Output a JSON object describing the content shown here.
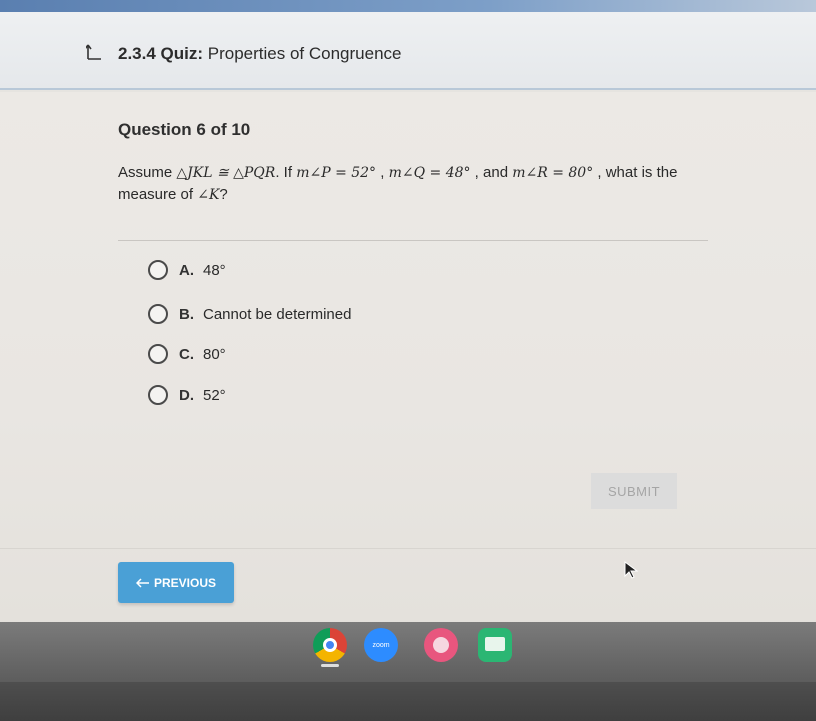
{
  "header": {
    "quiz_label": "2.3.4 Quiz:",
    "quiz_name": "Properties of Congruence"
  },
  "question": {
    "number_text": "Question 6 of 10",
    "text_part1": "Assume ",
    "math1": "△JKL ≅ △PQR",
    "text_part2": ". If ",
    "math2": "m∠P = 52°",
    "text_part3": " , ",
    "math3": "m∠Q = 48°",
    "text_part4": " , and ",
    "math4": "m∠R = 80°",
    "text_part5": " , what is the measure of ",
    "math5": "∠K",
    "text_part6": "?"
  },
  "options": [
    {
      "letter": "A.",
      "text": "48°"
    },
    {
      "letter": "B.",
      "text": "Cannot be determined"
    },
    {
      "letter": "C.",
      "text": "80°"
    },
    {
      "letter": "D.",
      "text": "52°"
    }
  ],
  "buttons": {
    "submit_label": "SUBMIT",
    "previous_label": "PREVIOUS"
  },
  "taskbar": {
    "zoom_label": "zoom"
  },
  "colors": {
    "accent": "#4aa0d6",
    "submit_disabled": "#dcdcdc"
  }
}
